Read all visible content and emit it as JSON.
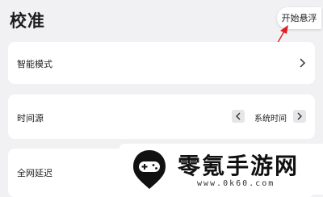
{
  "header": {
    "title": "校准",
    "float_button_label": "开始悬浮"
  },
  "settings": [
    {
      "label": "智能模式",
      "control": "chevron-right-icon"
    },
    {
      "label": "时间源",
      "control": "stepper",
      "value": "系统时间"
    },
    {
      "label": "全网延迟"
    }
  ],
  "watermark": {
    "brand": "零氪手游网",
    "url": "www.0k60.com"
  },
  "colors": {
    "background": "#f1f1f3",
    "card": "#ffffff",
    "annotation_arrow": "#e02020",
    "stepper_bg": "#e6e6e9"
  }
}
